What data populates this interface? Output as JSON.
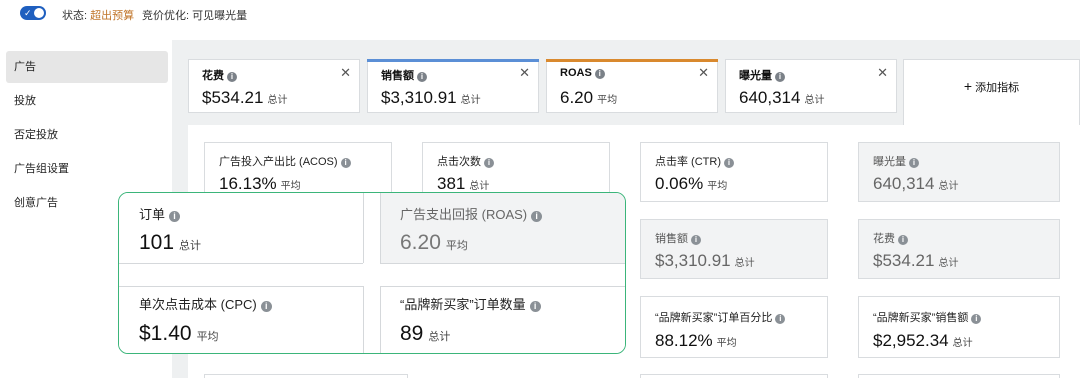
{
  "topbar": {
    "status_label": "状态: ",
    "status_value": "超出预算",
    "bid_label": "竞价优化: 可见曝光量",
    "toggle_check": "✓"
  },
  "sidebar": {
    "items": [
      {
        "label": "广告"
      },
      {
        "label": "投放"
      },
      {
        "label": "否定投放"
      },
      {
        "label": "广告组设置"
      },
      {
        "label": "创意广告"
      }
    ]
  },
  "tabs": [
    {
      "label": "花费",
      "value": "$534.21",
      "unit": "总计",
      "close": "✕",
      "accent": ""
    },
    {
      "label": "销售额",
      "value": "$3,310.91",
      "unit": "总计",
      "close": "✕",
      "accent": "#5b8fd6"
    },
    {
      "label": "ROAS",
      "value": "6.20",
      "unit": "平均",
      "close": "✕",
      "accent": "#d9892e"
    },
    {
      "label": "曝光量",
      "value": "640,314",
      "unit": "总计",
      "close": "✕",
      "accent": ""
    }
  ],
  "add_metric": {
    "plus": "+",
    "label": "添加指标"
  },
  "info_glyph": "i",
  "cards": [
    {
      "label": "广告投入产出比 (ACOS)",
      "value": "16.13%",
      "unit": "平均"
    },
    {
      "label": "点击次数",
      "value": "381",
      "unit": "总计"
    },
    {
      "label": "点击率 (CTR)",
      "value": "0.06%",
      "unit": "平均"
    },
    {
      "label": "曝光量",
      "value": "640,314",
      "unit": "总计"
    },
    {
      "label": "销售额",
      "value": "$3,310.91",
      "unit": "总计"
    },
    {
      "label": "花费",
      "value": "$534.21",
      "unit": "总计"
    },
    {
      "label": "“品牌新买家”订单百分比",
      "value": "88.12%",
      "unit": "平均"
    },
    {
      "label": "“品牌新买家”销售额",
      "value": "$2,952.34",
      "unit": "总计"
    }
  ],
  "highlight": [
    {
      "label": "订单",
      "value": "101",
      "unit": "总计"
    },
    {
      "label": "广告支出回报 (ROAS)",
      "value": "6.20",
      "unit": "平均"
    },
    {
      "label": "单次点击成本 (CPC)",
      "value": "$1.40",
      "unit": "平均"
    },
    {
      "label": "“品牌新买家”订单数量",
      "value": "89",
      "unit": "总计"
    }
  ],
  "colors": {
    "toggle": "#1f5fbf",
    "status_warning": "#c0752a",
    "highlight_border": "#3bb57a",
    "sales_accent": "#5b8fd6",
    "roas_accent": "#d9892e"
  }
}
